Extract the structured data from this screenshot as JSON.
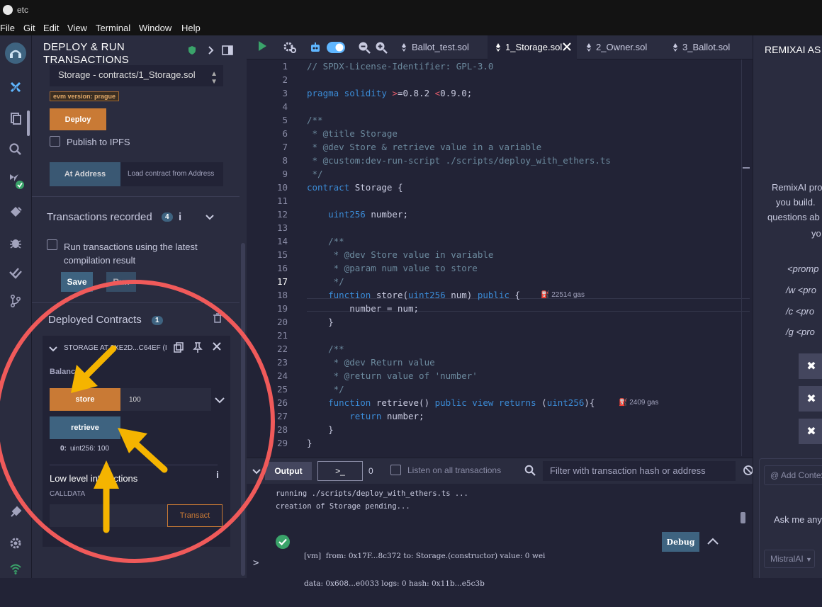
{
  "window": {
    "title": "etc"
  },
  "menu": [
    "File",
    "Git",
    "Edit",
    "View",
    "Terminal",
    "Window",
    "Help"
  ],
  "iconbar": [
    "remix-logo-icon",
    "ai-plugin-icon",
    "file-explorer-icon",
    "search-icon",
    "solidity-compiler-icon",
    "deploy-icon",
    "debugger-icon",
    "unit-test-icon",
    "git-icon",
    "plugin-icon",
    "settings-icon",
    "network-icon"
  ],
  "deploy": {
    "header_line1": "DEPLOY & RUN",
    "header_line2": "TRANSACTIONS",
    "contract_select": "Storage - contracts/1_Storage.sol",
    "evm_badge": "evm version: prague",
    "deploy_label": "Deploy",
    "publish_ipfs": "Publish to IPFS",
    "at_address_label": "At Address",
    "load_placeholder": "Load contract from Address",
    "tx_recorded_label": "Transactions recorded",
    "tx_recorded_count": "4",
    "run_latest_line1": "Run transactions using the latest",
    "run_latest_line2": "compilation result",
    "save_label": "Save",
    "run_label": "Run",
    "deployed_label": "Deployed Contracts",
    "deployed_count": "1",
    "instance_title": "STORAGE AT 0XE2D...C64EF (I",
    "balance_label": "Balance:",
    "store_label": "store",
    "store_value": "100",
    "retrieve_label": "retrieve",
    "retrieve_result_index": "0:",
    "retrieve_result_value": "uint256: 100",
    "low_level_label": "Low level interactions",
    "calldata_label": "CALLDATA",
    "transact_label": "Transact"
  },
  "tabs": [
    {
      "label": "Ballot_test.sol"
    },
    {
      "label": "1_Storage.sol"
    },
    {
      "label": "2_Owner.sol"
    },
    {
      "label": "3_Ballot.sol"
    }
  ],
  "code": {
    "line_numbers": [
      "1",
      "2",
      "3",
      "4",
      "5",
      "6",
      "7",
      "8",
      "9",
      "10",
      "11",
      "12",
      "13",
      "14",
      "15",
      "16",
      "17",
      "18",
      "19",
      "20",
      "21",
      "22",
      "23",
      "24",
      "25",
      "26",
      "27",
      "28",
      "29"
    ],
    "l1": "// SPDX-License-Identifier: GPL-3.0",
    "l3_kw": "pragma solidity",
    "l3_gt": ">",
    "l3_v1": "=0.8.2 ",
    "l3_lt": "<",
    "l3_v2": "0.9.0;",
    "l5": "/**",
    "l6": " * @title Storage",
    "l7": " * @dev Store & retrieve value in a variable",
    "l8": " * @custom:dev-run-script ./scripts/deploy_with_ethers.ts",
    "l9": " */",
    "l10_kw": "contract",
    "l10_rest": " Storage {",
    "l12_type": "    uint256",
    "l12_rest": " number;",
    "l14": "    /**",
    "l15": "     * @dev Store value in variable",
    "l16": "     * @param num value to store",
    "l17": "     */",
    "l18_kw": "    function",
    "l18_rest": " store(",
    "l18_type": "uint256",
    "l18_rest2": " num) ",
    "l18_kw2": "public",
    "l18_rest3": " {",
    "l18_gas": "22514 gas",
    "l19": "        number = num;",
    "l20": "    }",
    "l22": "    /**",
    "l23": "     * @dev Return value",
    "l24": "     * @return value of 'number'",
    "l25": "     */",
    "l26_kw": "    function",
    "l26_rest": " retrieve() ",
    "l26_kw2": "public view returns",
    "l26_rest2": " (",
    "l26_type": "uint256",
    "l26_rest3": "){",
    "l26_gas": "2409 gas",
    "l27_kw": "        return",
    "l27_rest": " number;",
    "l28": "    }",
    "l29": "}"
  },
  "terminal": {
    "output_label": "Output",
    "prompt_glyph": ">_",
    "count": "0",
    "listen_label": "Listen on all transactions",
    "filter_placeholder": "Filter with transaction hash or address",
    "log1": "running ./scripts/deploy_with_ethers.ts ...",
    "log2": "creation of Storage pending...",
    "tx_line1": "[vm]  from: 0x17F...8c372 to: Storage.(constructor) value: 0 wei",
    "tx_line2": "data: 0x608...e0033 logs: 0 hash: 0x11b...e5c3b",
    "debug_label": "Debug",
    "prompt": ">"
  },
  "ai": {
    "title": "REMIXAI AS",
    "desc1": "RemixAI pro",
    "desc2": "you build.",
    "desc3": "questions ab",
    "desc4": "yo",
    "cmd1": "<promp",
    "cmd2": "/w <pro",
    "cmd3": "/c <pro",
    "cmd4": "/g <pro",
    "context_label": "@ Add Contex",
    "ask_label": "Ask me any",
    "model_label": "MistralAI"
  },
  "colors": {
    "accent_orange": "#c97a35",
    "accent_blue": "#3e6380",
    "annotation_red": "#f05a5a",
    "annotation_yellow": "#f5b400"
  }
}
